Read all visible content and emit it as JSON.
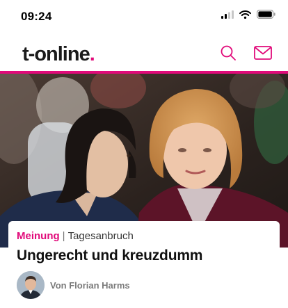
{
  "status_bar": {
    "time": "09:24",
    "icons": [
      "signal-icon",
      "wifi-icon",
      "battery-icon"
    ]
  },
  "header": {
    "logo_text": "t-online",
    "logo_dot": ".",
    "actions": [
      "search-icon",
      "mail-icon"
    ]
  },
  "colors": {
    "brand": "#e10a7a",
    "text": "#111111",
    "muted": "#7a7a7a"
  },
  "article": {
    "kicker_main": "Meinung",
    "kicker_separator": "|",
    "kicker_sub": "Tagesanbruch",
    "headline": "Ungerecht und kreuzdumm",
    "author": "Von Florian Harms"
  }
}
